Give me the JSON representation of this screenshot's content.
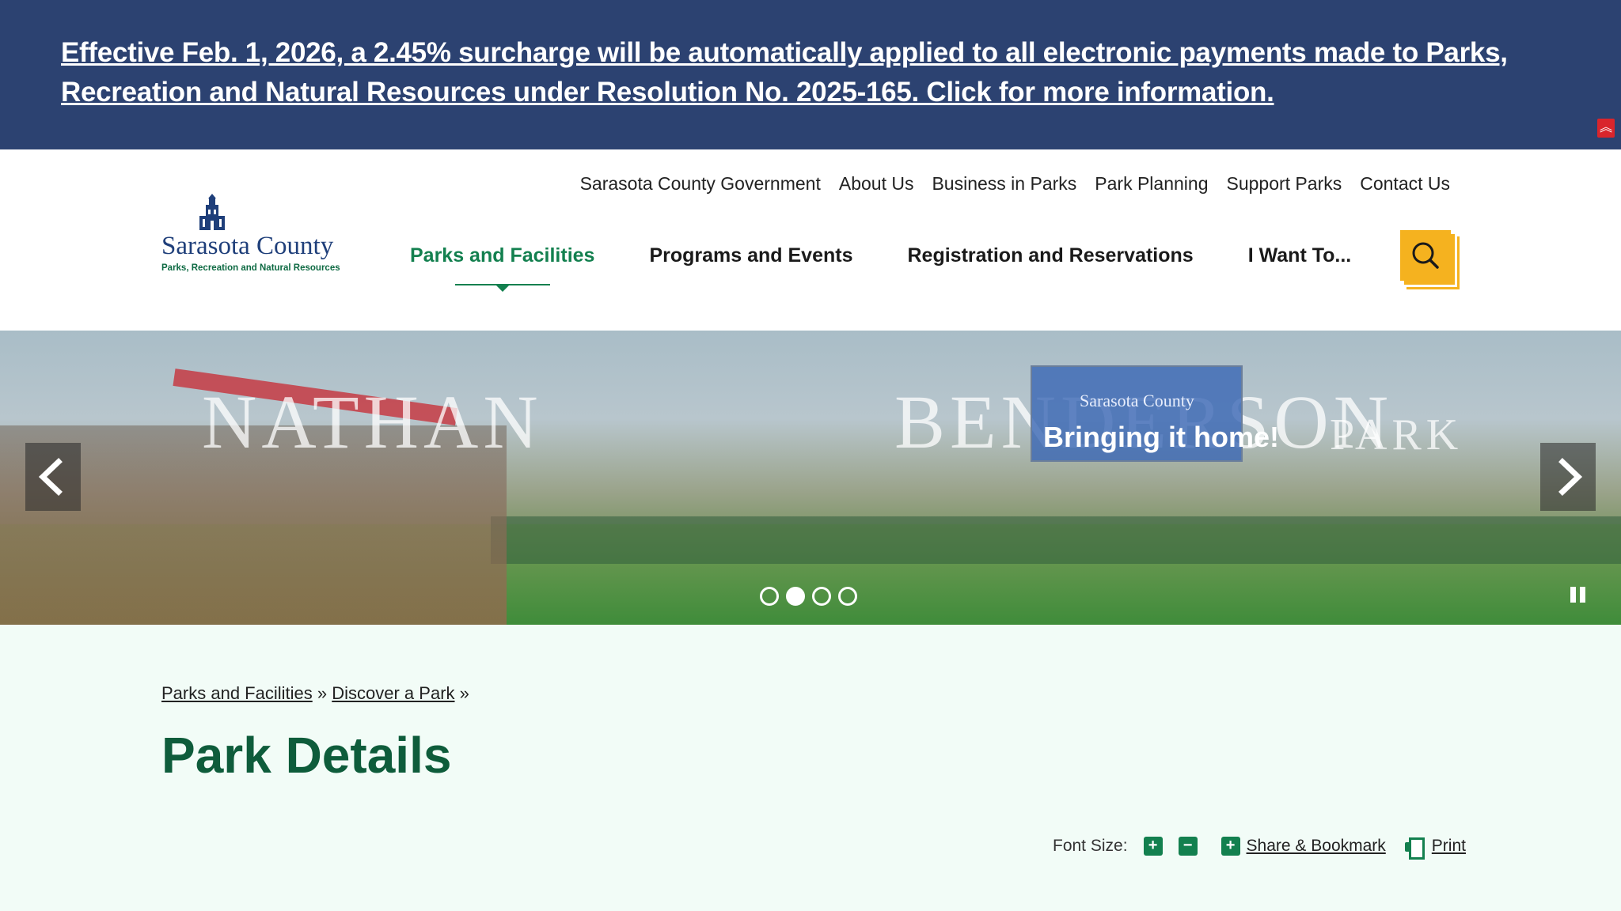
{
  "alert": {
    "text": "Effective Feb. 1, 2026, a 2.45% surcharge will be automatically applied to all electronic payments made to Parks, Recreation and Natural Resources under Resolution No. 2025-165. Click for more information.",
    "collapse_icon": "double-chevron-up-icon",
    "bg_color": "#2c4271"
  },
  "header": {
    "utility_nav": [
      "Sarasota County Government",
      "About Us",
      "Business in Parks",
      "Park Planning",
      "Support Parks",
      "Contact Us"
    ],
    "logo": {
      "name": "Sarasota County",
      "subtitle": "Parks, Recreation and Natural Resources"
    },
    "main_nav": [
      {
        "label": "Parks and Facilities",
        "active": true
      },
      {
        "label": "Programs and Events",
        "active": false
      },
      {
        "label": "Registration and Reservations",
        "active": false
      },
      {
        "label": "I Want To...",
        "active": false
      }
    ],
    "search_icon": "search-icon",
    "accent_color": "#13804f",
    "search_color": "#f5b21f"
  },
  "hero": {
    "image_text": {
      "word1": "NATHAN",
      "word2": "BENDERSON",
      "word3": "PARK",
      "sign_logo": "Sarasota County",
      "sign_text": "Bringing it home!"
    },
    "prev_icon": "chevron-left-icon",
    "next_icon": "chevron-right-icon",
    "slides_total": 4,
    "active_slide": 2,
    "pause_icon": "pause-icon"
  },
  "content": {
    "breadcrumb": [
      {
        "label": "Parks and Facilities"
      },
      {
        "label": "Discover a Park"
      }
    ],
    "breadcrumb_separator": "»",
    "title": "Park Details",
    "tools": {
      "font_size_label": "Font Size:",
      "increase_icon": "plus-icon",
      "decrease_icon": "minus-icon",
      "share_label": "Share & Bookmark",
      "share_icon": "plus-icon",
      "print_label": "Print",
      "print_icon": "printer-icon"
    },
    "title_color": "#0e5c3b"
  }
}
